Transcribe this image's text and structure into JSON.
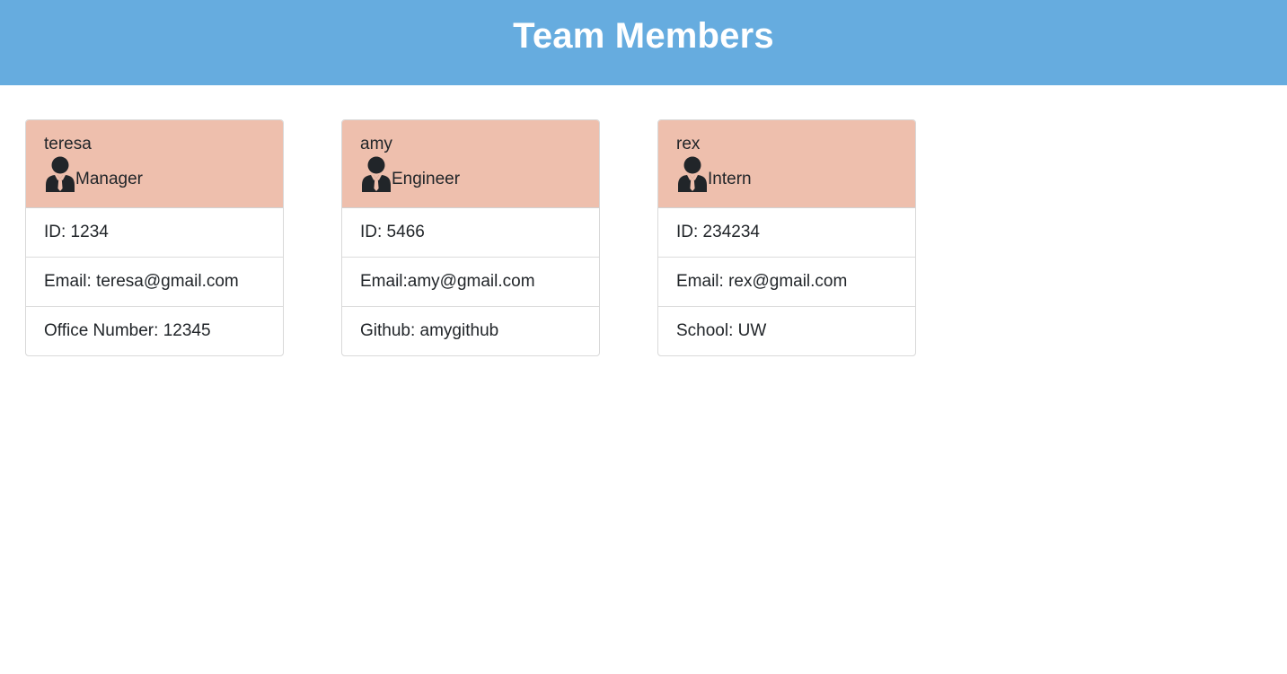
{
  "header": {
    "title": "Team Members"
  },
  "colors": {
    "header_bg": "#66acdf",
    "card_header_bg": "#eebfad"
  },
  "members": [
    {
      "name": "teresa",
      "role": "Manager",
      "icon": "user-tie-icon",
      "id_text": "ID: 1234",
      "email_text": "Email: teresa@gmail.com",
      "extra_text": "Office Number: 12345"
    },
    {
      "name": "amy",
      "role": "Engineer",
      "icon": "user-tie-icon",
      "id_text": "ID: 5466",
      "email_text": "Email:amy@gmail.com",
      "extra_text": "Github: amygithub"
    },
    {
      "name": "rex",
      "role": "Intern",
      "icon": "user-tie-icon",
      "id_text": "ID: 234234",
      "email_text": "Email: rex@gmail.com",
      "extra_text": "School: UW"
    }
  ]
}
